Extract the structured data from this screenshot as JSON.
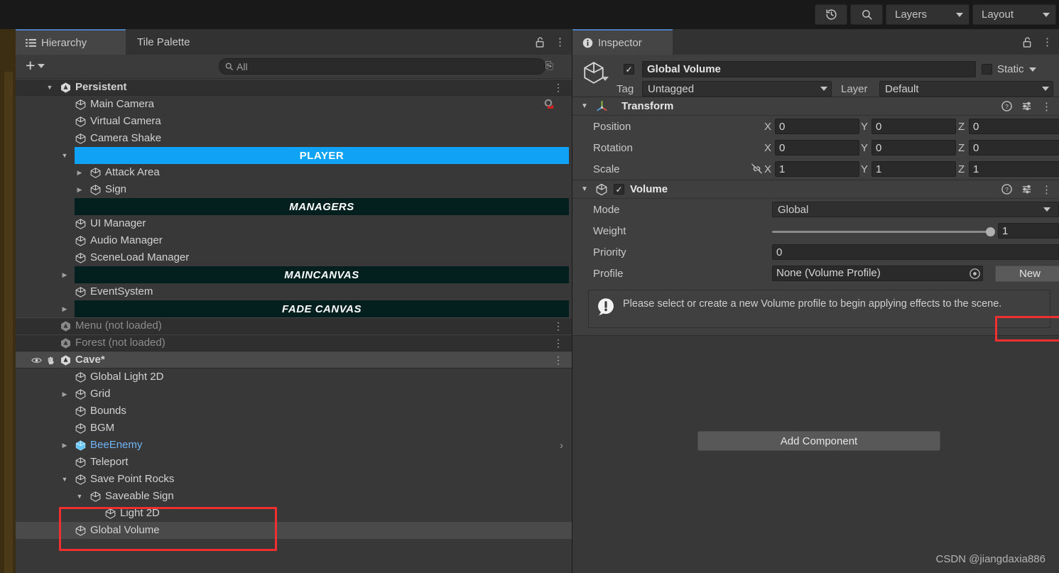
{
  "toolbar": {
    "history_icon": "history-undo-icon",
    "search_icon": "search-icon",
    "layers_label": "Layers",
    "layout_label": "Layout"
  },
  "hierarchy": {
    "tabs": [
      {
        "label": "Hierarchy",
        "icon": "hierarchy-list-icon",
        "active": true
      },
      {
        "label": "Tile Palette",
        "icon": "",
        "active": false
      }
    ],
    "lock_icon": "lock-open-icon",
    "menu_icon": "kebab-menu-icon",
    "create_label": "+",
    "search": {
      "placeholder": "All",
      "value": "",
      "icon": "search-icon"
    },
    "tree": [
      {
        "name": "Persistent",
        "type": "scene",
        "indent": 1,
        "arrow": "open",
        "kebab": true
      },
      {
        "name": "Main Camera",
        "type": "go",
        "indent": 2,
        "arrow": "none",
        "badge": "camera-gear-icon"
      },
      {
        "name": "Virtual Camera",
        "type": "go",
        "indent": 2,
        "arrow": "none"
      },
      {
        "name": "Camera Shake",
        "type": "go",
        "indent": 2,
        "arrow": "none"
      },
      {
        "name": "PLAYER",
        "type": "banner-player",
        "indent": 2,
        "arrow": "open"
      },
      {
        "name": "Attack Area",
        "type": "go",
        "indent": 3,
        "arrow": "closed"
      },
      {
        "name": "Sign",
        "type": "go",
        "indent": 3,
        "arrow": "closed"
      },
      {
        "name": "MANAGERS",
        "type": "banner-dark",
        "indent": 2,
        "arrow": "none"
      },
      {
        "name": "UI Manager",
        "type": "go",
        "indent": 2,
        "arrow": "none"
      },
      {
        "name": "Audio Manager",
        "type": "go",
        "indent": 2,
        "arrow": "none"
      },
      {
        "name": "SceneLoad Manager",
        "type": "go",
        "indent": 2,
        "arrow": "none"
      },
      {
        "name": "MAINCANVAS",
        "type": "banner-dark",
        "indent": 2,
        "arrow": "closed"
      },
      {
        "name": "EventSystem",
        "type": "go",
        "indent": 2,
        "arrow": "none"
      },
      {
        "name": "FADE CANVAS",
        "type": "banner-dark",
        "indent": 2,
        "arrow": "closed"
      },
      {
        "name": "Menu (not loaded)",
        "type": "scene-unloaded",
        "indent": 1,
        "arrow": "none",
        "kebab": true
      },
      {
        "name": "Forest (not loaded)",
        "type": "scene-unloaded",
        "indent": 1,
        "arrow": "none",
        "kebab": true
      },
      {
        "name": "Cave*",
        "type": "scene-active",
        "indent": 1,
        "arrow": "open",
        "kebab": true,
        "vis": true
      },
      {
        "name": "Global Light 2D",
        "type": "go",
        "indent": 2,
        "arrow": "none"
      },
      {
        "name": "Grid",
        "type": "go",
        "indent": 2,
        "arrow": "closed"
      },
      {
        "name": "Bounds",
        "type": "go",
        "indent": 2,
        "arrow": "none"
      },
      {
        "name": "BGM",
        "type": "go",
        "indent": 2,
        "arrow": "none"
      },
      {
        "name": "BeeEnemy",
        "type": "prefab",
        "indent": 2,
        "arrow": "closed",
        "chevron": true
      },
      {
        "name": "Teleport",
        "type": "go",
        "indent": 2,
        "arrow": "none"
      },
      {
        "name": "Save Point Rocks",
        "type": "go",
        "indent": 2,
        "arrow": "open"
      },
      {
        "name": "Saveable Sign",
        "type": "go",
        "indent": 3,
        "arrow": "open"
      },
      {
        "name": "Light 2D",
        "type": "go",
        "indent": 4,
        "arrow": "none"
      },
      {
        "name": "Global Volume",
        "type": "go",
        "indent": 2,
        "arrow": "none",
        "selected": true
      }
    ]
  },
  "inspector": {
    "tab_label": "Inspector",
    "tab_icon": "info-icon",
    "lock_icon": "lock-open-icon",
    "menu_icon": "kebab-menu-icon",
    "object": {
      "icon": "gameobject-cube-icon",
      "enabled": true,
      "name": "Global Volume",
      "static_label": "Static",
      "static_checked": false,
      "tag_label": "Tag",
      "tag_value": "Untagged",
      "layer_label": "Layer",
      "layer_value": "Default"
    },
    "transform": {
      "title": "Transform",
      "icon": "transform-axis-icon",
      "help_icon": "help-icon",
      "preset_icon": "preset-settings-icon",
      "menu_icon": "kebab-menu-icon",
      "rows": [
        {
          "label": "Position",
          "x": "0",
          "y": "0",
          "z": "0"
        },
        {
          "label": "Rotation",
          "x": "0",
          "y": "0",
          "z": "0"
        },
        {
          "label": "Scale",
          "x": "1",
          "y": "1",
          "z": "1",
          "link_icon": "constrain-proportions-off-icon"
        }
      ],
      "axis_labels": [
        "X",
        "Y",
        "Z"
      ]
    },
    "volume": {
      "title": "Volume",
      "icon": "volume-component-icon",
      "enabled": true,
      "help_icon": "help-icon",
      "preset_icon": "preset-settings-icon",
      "menu_icon": "kebab-menu-icon",
      "mode_label": "Mode",
      "mode_value": "Global",
      "weight_label": "Weight",
      "weight_value": "1",
      "weight_percent": 100,
      "priority_label": "Priority",
      "priority_value": "0",
      "profile_label": "Profile",
      "profile_value": "None (Volume Profile)",
      "profile_picker_icon": "object-picker-icon",
      "new_button_label": "New",
      "warning_icon": "warning-exclamation-icon",
      "warning_text": "Please select or create a new Volume profile to begin applying effects to the scene."
    },
    "add_component_label": "Add Component"
  },
  "watermark": "CSDN @jiangdaxia886"
}
